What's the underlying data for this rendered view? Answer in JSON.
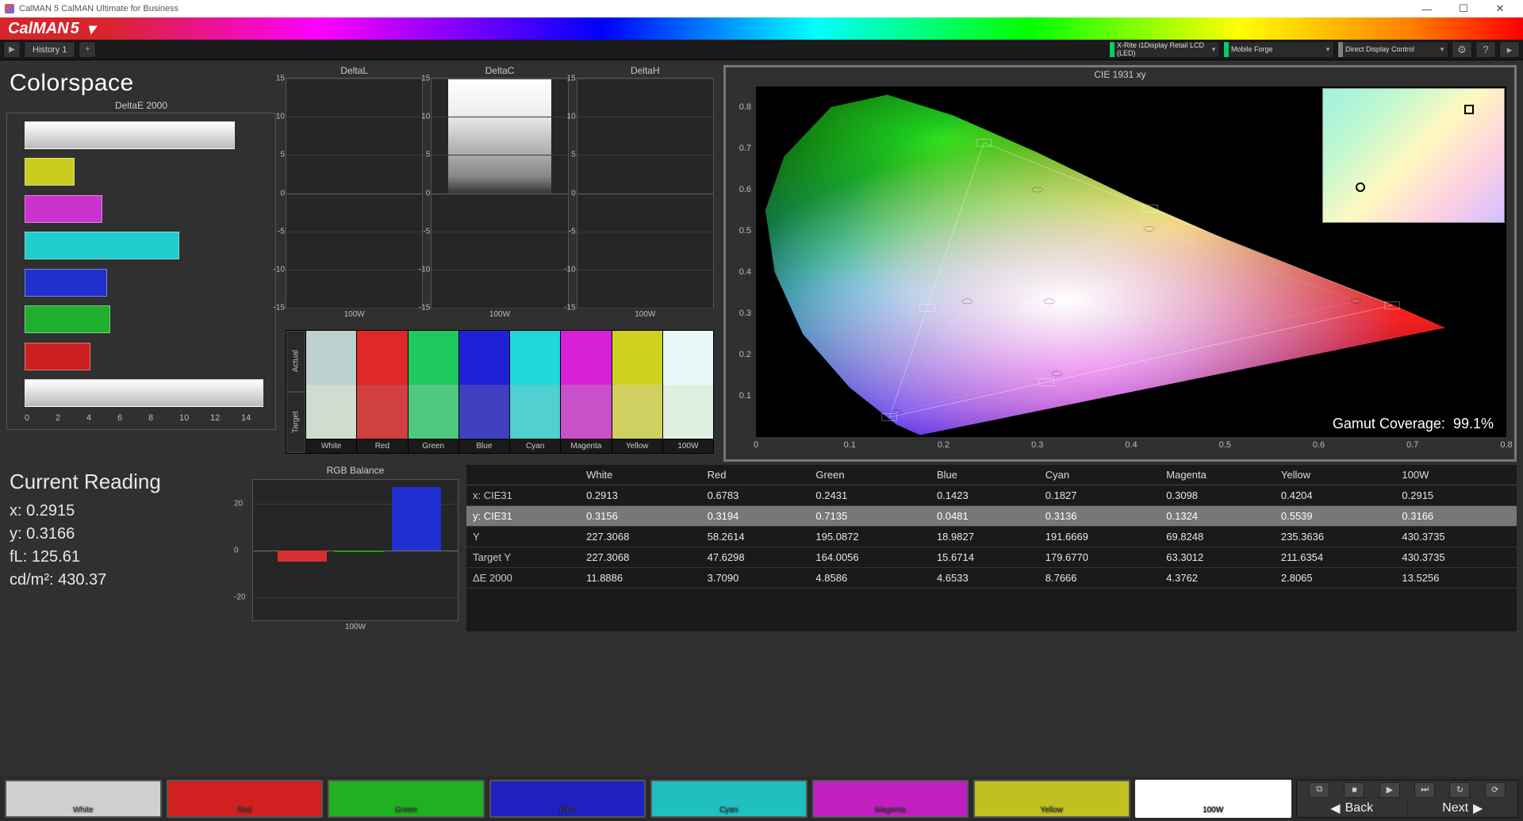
{
  "os_title": "CalMAN 5 CalMAN Ultimate for Business",
  "brand": {
    "name": "CalMAN",
    "ver": "5"
  },
  "tabs": {
    "history": "History 1"
  },
  "devices": [
    {
      "label": "X-Rite i1Display Retail LCD (LED)",
      "color": "#00d060"
    },
    {
      "label": "Mobile Forge",
      "color": "#00d060"
    },
    {
      "label": "Direct Display Control",
      "color": "#808080"
    }
  ],
  "section_title": "Colorspace",
  "chart_data": [
    {
      "id": "deltaE2000",
      "type": "bar",
      "title": "DeltaE 2000",
      "orientation": "horizontal",
      "xlim": [
        0,
        14
      ],
      "xticks": [
        0,
        2,
        4,
        6,
        8,
        10,
        12,
        14
      ],
      "categories": [
        "White",
        "Yellow",
        "Magenta",
        "Cyan",
        "Blue",
        "Green",
        "Red",
        "100W"
      ],
      "values": [
        11.8886,
        2.8065,
        4.3762,
        8.7666,
        4.6533,
        4.8586,
        3.709,
        13.5256
      ],
      "colors": [
        "#e8e8e8",
        "#cccc20",
        "#cc33cc",
        "#20cccc",
        "#2030cc",
        "#20b030",
        "#cc2020",
        "#d8d8d8"
      ]
    },
    {
      "id": "deltaL",
      "type": "bar",
      "title": "DeltaL",
      "ylim": [
        -15,
        15
      ],
      "yticks": [
        -15,
        -10,
        -5,
        0,
        5,
        10,
        15
      ],
      "categories": [
        "100W"
      ],
      "values": [
        0
      ],
      "xlabel": "100W"
    },
    {
      "id": "deltaC",
      "type": "bar",
      "title": "DeltaC",
      "ylim": [
        -15,
        15
      ],
      "yticks": [
        -15,
        -10,
        -5,
        0,
        5,
        10,
        15
      ],
      "categories": [
        "100W"
      ],
      "values": [
        15
      ],
      "xlabel": "100W",
      "note": "gradient-bar"
    },
    {
      "id": "deltaH",
      "type": "bar",
      "title": "DeltaH",
      "ylim": [
        -15,
        15
      ],
      "yticks": [
        -15,
        -10,
        -5,
        0,
        5,
        10,
        15
      ],
      "categories": [
        "100W"
      ],
      "values": [
        0
      ],
      "xlabel": "100W"
    },
    {
      "id": "rgbBalance",
      "type": "bar",
      "title": "RGB Balance",
      "ylim": [
        -30,
        30
      ],
      "yticks": [
        -20,
        0,
        20
      ],
      "xlabel": "100W",
      "series": [
        {
          "name": "R",
          "value": -5,
          "color": "#d83030"
        },
        {
          "name": "G",
          "value": -1,
          "color": "#20a020"
        },
        {
          "name": "B",
          "value": 27,
          "color": "#2030d0"
        }
      ]
    },
    {
      "id": "cie1931",
      "type": "scatter",
      "title": "CIE 1931 xy",
      "xlim": [
        0,
        0.8
      ],
      "ylim": [
        0,
        0.85
      ],
      "xticks": [
        0,
        0.1,
        0.2,
        0.3,
        0.4,
        0.5,
        0.6,
        0.7,
        0.8
      ],
      "yticks": [
        0.1,
        0.2,
        0.3,
        0.4,
        0.5,
        0.6,
        0.7,
        0.8
      ],
      "measured": [
        {
          "name": "White",
          "x": 0.2913,
          "y": 0.3156
        },
        {
          "name": "Red",
          "x": 0.6783,
          "y": 0.3194
        },
        {
          "name": "Green",
          "x": 0.2431,
          "y": 0.7135
        },
        {
          "name": "Blue",
          "x": 0.1423,
          "y": 0.0481
        },
        {
          "name": "Cyan",
          "x": 0.1827,
          "y": 0.3136
        },
        {
          "name": "Magenta",
          "x": 0.3098,
          "y": 0.1324
        },
        {
          "name": "Yellow",
          "x": 0.4204,
          "y": 0.5539
        },
        {
          "name": "100W",
          "x": 0.2915,
          "y": 0.3166
        }
      ],
      "target": [
        {
          "name": "Red",
          "x": 0.64,
          "y": 0.33
        },
        {
          "name": "Green",
          "x": 0.3,
          "y": 0.6
        },
        {
          "name": "Blue",
          "x": 0.15,
          "y": 0.06
        },
        {
          "name": "Cyan",
          "x": 0.225,
          "y": 0.329
        },
        {
          "name": "Magenta",
          "x": 0.321,
          "y": 0.154
        },
        {
          "name": "Yellow",
          "x": 0.419,
          "y": 0.505
        },
        {
          "name": "White",
          "x": 0.3127,
          "y": 0.329
        }
      ],
      "gamut_coverage_label": "Gamut Coverage:",
      "gamut_coverage": "99.1%"
    }
  ],
  "swatch_rows": {
    "actual_label": "Actual",
    "target_label": "Target"
  },
  "swatches": [
    {
      "label": "White",
      "actual": "#bcd0d0",
      "target": "#d0dcd0"
    },
    {
      "label": "Red",
      "actual": "#e02828",
      "target": "#d04040"
    },
    {
      "label": "Green",
      "actual": "#20c860",
      "target": "#50c880"
    },
    {
      "label": "Blue",
      "actual": "#2020d8",
      "target": "#4040c0"
    },
    {
      "label": "Cyan",
      "actual": "#20d8d8",
      "target": "#50d0d0"
    },
    {
      "label": "Magenta",
      "actual": "#d820d8",
      "target": "#c850c8"
    },
    {
      "label": "Yellow",
      "actual": "#d0d020",
      "target": "#d0d060"
    },
    {
      "label": "100W",
      "actual": "#e8f8f8",
      "target": "#e0f0e0"
    }
  ],
  "reading": {
    "title": "Current Reading",
    "x_label": "x:",
    "x": "0.2915",
    "y_label": "y:",
    "y": "0.3166",
    "fL_label": "fL:",
    "fL": "125.61",
    "cdm2_label": "cd/m²:",
    "cdm2": "430.37"
  },
  "table": {
    "columns": [
      "",
      "White",
      "Red",
      "Green",
      "Blue",
      "Cyan",
      "Magenta",
      "Yellow",
      "100W"
    ],
    "rows": [
      {
        "k": "x: CIE31",
        "v": [
          "0.2913",
          "0.6783",
          "0.2431",
          "0.1423",
          "0.1827",
          "0.3098",
          "0.4204",
          "0.2915"
        ]
      },
      {
        "k": "y: CIE31",
        "v": [
          "0.3156",
          "0.3194",
          "0.7135",
          "0.0481",
          "0.3136",
          "0.1324",
          "0.5539",
          "0.3166"
        ],
        "sel": true
      },
      {
        "k": "Y",
        "v": [
          "227.3068",
          "58.2614",
          "195.0872",
          "18.9827",
          "191.6669",
          "69.8248",
          "235.3636",
          "430.3735"
        ]
      },
      {
        "k": "Target Y",
        "v": [
          "227.3068",
          "47.6298",
          "164.0056",
          "15.6714",
          "179.6770",
          "63.3012",
          "211.6354",
          "430.3735"
        ]
      },
      {
        "k": "ΔE 2000",
        "v": [
          "11.8886",
          "3.7090",
          "4.8586",
          "4.6533",
          "8.7666",
          "4.3762",
          "2.8065",
          "13.5256"
        ]
      }
    ]
  },
  "bottom_swatches": [
    {
      "label": "White",
      "color": "#d0d0d0"
    },
    {
      "label": "Red",
      "color": "#d02020"
    },
    {
      "label": "Green",
      "color": "#20b020"
    },
    {
      "label": "Blue",
      "color": "#2020c0"
    },
    {
      "label": "Cyan",
      "color": "#20c0c0"
    },
    {
      "label": "Magenta",
      "color": "#c020c0"
    },
    {
      "label": "Yellow",
      "color": "#c0c020"
    },
    {
      "label": "100W",
      "color": "#ffffff",
      "sel": true
    }
  ],
  "nav": {
    "back": "Back",
    "next": "Next"
  }
}
